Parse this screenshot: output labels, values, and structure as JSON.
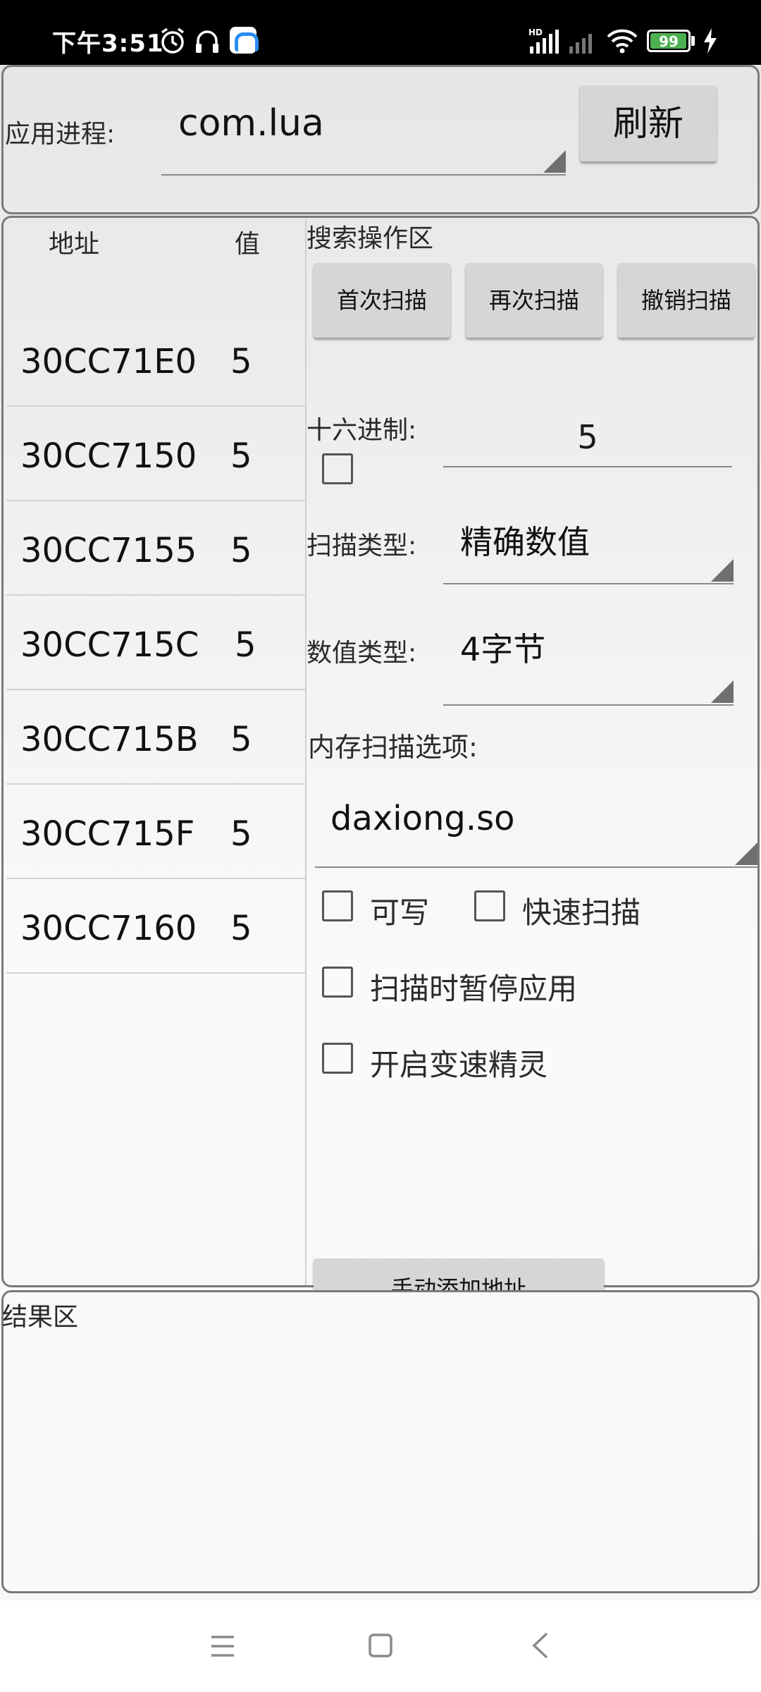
{
  "status_bar": {
    "time": "下午3:51",
    "battery": "99",
    "battery_level": 0.99,
    "icons": [
      "alarm-icon",
      "headset-icon",
      "app-notification-icon",
      "hd-signal-icon",
      "signal-icon",
      "wifi-icon",
      "battery-icon",
      "charging-icon"
    ]
  },
  "process": {
    "label": "应用进程:",
    "selected": "com.lua",
    "refresh_button": "刷新"
  },
  "address_list": {
    "header_address": "地址",
    "header_value": "值",
    "rows": [
      {
        "address": "30CC71E0",
        "value": "5"
      },
      {
        "address": "30CC7150",
        "value": "5"
      },
      {
        "address": "30CC7155",
        "value": "5"
      },
      {
        "address": "30CC715C",
        "value": "5"
      },
      {
        "address": "30CC715B",
        "value": "5"
      },
      {
        "address": "30CC715F",
        "value": "5"
      },
      {
        "address": "30CC7160",
        "value": "5"
      }
    ]
  },
  "search": {
    "title": "搜索操作区",
    "first_scan": "首次扫描",
    "next_scan": "再次扫描",
    "undo_scan": "撤销扫描",
    "hex_label": "十六进制:",
    "hex_checked": false,
    "value_input": "5",
    "scan_type_label": "扫描类型:",
    "scan_type": "精确数值",
    "value_type_label": "数值类型:",
    "value_type": "4字节",
    "memory_label": "内存扫描选项:",
    "memory_option": "daxiong.so",
    "writable": "可写",
    "fast_scan": "快速扫描",
    "pause_app": "扫描时暂停应用",
    "speed_hack": "开启变速精灵",
    "manual_add": "手动添加地址"
  },
  "results": {
    "title": "结果区"
  },
  "nav": {
    "icons": [
      "menu-icon",
      "home-icon",
      "back-icon"
    ]
  }
}
